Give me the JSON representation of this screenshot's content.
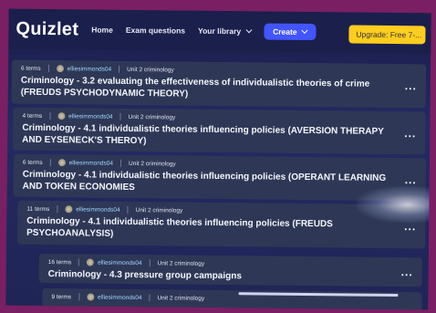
{
  "header": {
    "logo": "Quizlet",
    "nav": [
      "Home",
      "Exam questions",
      "Your library"
    ],
    "create_label": "Create",
    "upgrade_label": "Upgrade: Free 7-..."
  },
  "sets": [
    {
      "terms": "6 terms",
      "user": "elliesimmonds04",
      "folder": "Unit 2 criminology",
      "title": "Criminology - 3.2 evaluating the effectiveness of individualistic theories of crime (FREUDS PSYCHODYNAMIC THEORY)",
      "more": "..."
    },
    {
      "terms": "4 terms",
      "user": "elliesimmonds04",
      "folder": "Unit 2 criminology",
      "title": "Criminology - 4.1 individualistic theories influencing policies (AVERSION THERAPY AND EYSENECK'S THEROY)",
      "more": "..."
    },
    {
      "terms": "6 terms",
      "user": "elliesimmonds04",
      "folder": "Unit 2 criminology",
      "title": "Criminology - 4.1 individualistic theories influencing policies (OPERANT LEARNING AND TOKEN ECONOMIES",
      "more": "..."
    },
    {
      "terms": "11 terms",
      "user": "elliesimmonds04",
      "folder": "Unit 2 criminology",
      "title": "Criminology - 4.1 individualistic theories influencing policies (FREUDS PSYCHOANALYSIS)",
      "more": "..."
    },
    {
      "terms": "16 terms",
      "user": "elliesimmonds04",
      "folder": "Unit 2 criminology",
      "title": "Criminology - 4.3 pressure group campaigns",
      "more": "..."
    },
    {
      "terms": "9 terms",
      "user": "elliesimmonds04",
      "folder": "Unit 2 criminology",
      "title": "",
      "more": ""
    }
  ],
  "colors": {
    "accent": "#4255ff",
    "upgrade": "#ffcd1f",
    "card": "#2e3856",
    "frame": "#7a1f63"
  }
}
